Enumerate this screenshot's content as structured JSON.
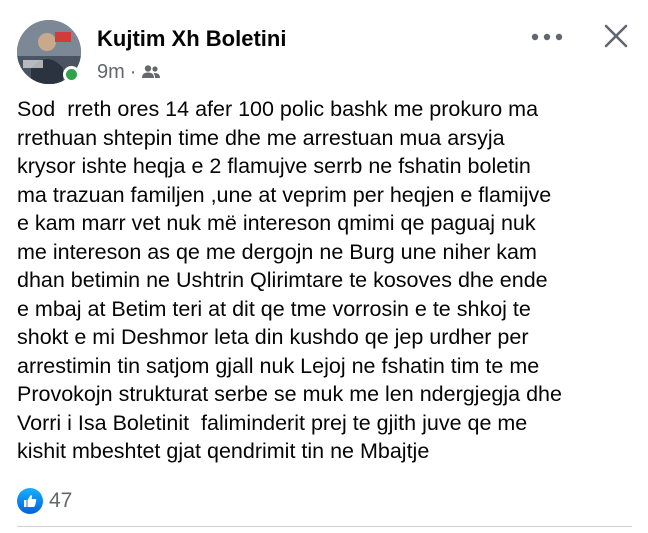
{
  "post": {
    "author_name": "Kujtim Xh Boletini",
    "timestamp": "9m",
    "separator": "·",
    "audience_icon": "friends-icon",
    "online_status_color": "#31a24c",
    "text_lines": [
      "Sod  rreth ores 14 afer 100 polic bashk me prokuro ma",
      "rrethuan shtepin time dhe me arrestuan mua arsyja",
      "krysor ishte heqja e 2 flamujve serrb ne fshatin boletin",
      "ma trazuan familjen ,une at veprim per heqjen e flamijve",
      "e kam marr vet nuk më intereson qmimi qe paguaj nuk",
      "me intereson as qe me dergojn ne Burg une niher kam",
      "dhan betimin ne Ushtrin Qlirimtare te kosoves dhe ende",
      "e mbaj at Betim teri at dit qe tme vorrosin e te shkoj te",
      "shokt e mi Deshmor leta din kushdo qe jep urdher per",
      "arrestimin tin satjom gjall nuk Lejoj ne fshatin tim te me",
      "Provokojn strukturat serbe se muk me len ndergjegja dhe",
      "Vorri i Isa Boletinit  faliminderit prej te gjith juve qe me",
      "kishit mbeshtet gjat qendrimit tin ne Mbajtje"
    ],
    "reaction_icon": "like-icon",
    "reaction_count": "47",
    "like_color": "#1877f2"
  },
  "toolbar": {
    "more_icon": "more-horizontal-icon",
    "close_icon": "close-icon"
  }
}
